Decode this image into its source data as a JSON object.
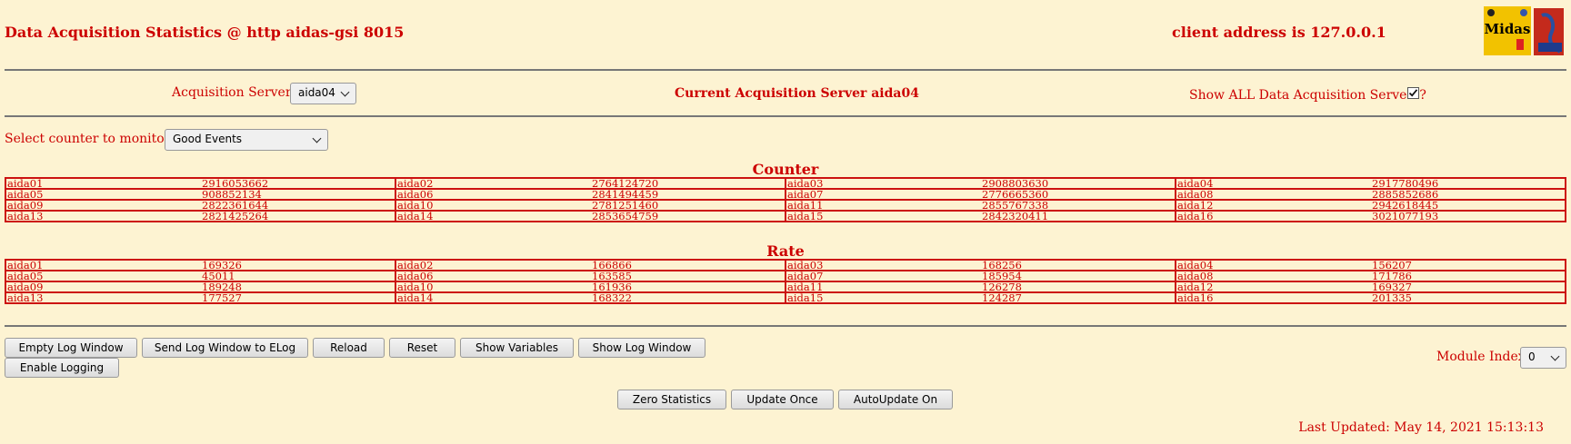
{
  "header": {
    "title": "Data Acquisition Statistics @ http aidas-gsi 8015",
    "client": "client address is 127.0.0.1"
  },
  "servers": {
    "label": "Acquisition Servers",
    "selected": "aida04",
    "current": "Current Acquisition Server aida04",
    "show_all_label": "Show ALL Data Acquisition Servers?",
    "show_all_checked": true
  },
  "counter_select": {
    "label": "Select counter to monitor",
    "selected": "Good Events"
  },
  "counter": {
    "title": "Counter",
    "rows": [
      [
        [
          "aida01",
          "2916053662"
        ],
        [
          "aida02",
          "2764124720"
        ],
        [
          "aida03",
          "2908803630"
        ],
        [
          "aida04",
          "2917780496"
        ]
      ],
      [
        [
          "aida05",
          "908852134"
        ],
        [
          "aida06",
          "2841494459"
        ],
        [
          "aida07",
          "2776665360"
        ],
        [
          "aida08",
          "2885852686"
        ]
      ],
      [
        [
          "aida09",
          "2822361644"
        ],
        [
          "aida10",
          "2781251460"
        ],
        [
          "aida11",
          "2855767338"
        ],
        [
          "aida12",
          "2942618445"
        ]
      ],
      [
        [
          "aida13",
          "2821425264"
        ],
        [
          "aida14",
          "2853654759"
        ],
        [
          "aida15",
          "2842320411"
        ],
        [
          "aida16",
          "3021077193"
        ]
      ]
    ]
  },
  "rate": {
    "title": "Rate",
    "rows": [
      [
        [
          "aida01",
          "169326"
        ],
        [
          "aida02",
          "166866"
        ],
        [
          "aida03",
          "168256"
        ],
        [
          "aida04",
          "156207"
        ]
      ],
      [
        [
          "aida05",
          "45011"
        ],
        [
          "aida06",
          "163585"
        ],
        [
          "aida07",
          "185954"
        ],
        [
          "aida08",
          "171786"
        ]
      ],
      [
        [
          "aida09",
          "189248"
        ],
        [
          "aida10",
          "161936"
        ],
        [
          "aida11",
          "126278"
        ],
        [
          "aida12",
          "169327"
        ]
      ],
      [
        [
          "aida13",
          "177527"
        ],
        [
          "aida14",
          "168322"
        ],
        [
          "aida15",
          "124287"
        ],
        [
          "aida16",
          "201335"
        ]
      ]
    ]
  },
  "buttons": {
    "empty_log": "Empty Log Window",
    "send_log": "Send Log Window to ELog",
    "reload": "Reload",
    "reset": "Reset",
    "show_variables": "Show Variables",
    "show_log": "Show Log Window",
    "enable_logging": "Enable Logging",
    "zero_stats": "Zero Statistics",
    "update_once": "Update Once",
    "autoupdate": "AutoUpdate On"
  },
  "module_index": {
    "label": "Module Index",
    "selected": "0"
  },
  "footer": {
    "last_updated": "Last Updated: May 14, 2021 15:13:13"
  },
  "colors": {
    "background": "#fdf3d2",
    "text": "#cc0000",
    "logo_yellow": "#f2c200"
  },
  "logos": {
    "midas": "Midas"
  }
}
